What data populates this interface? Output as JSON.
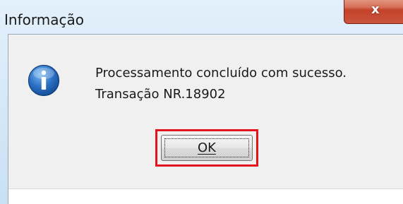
{
  "window": {
    "title": "Informação",
    "close_label": "x"
  },
  "dialog": {
    "icon": "info-icon",
    "message_line1": "Processamento concluído com sucesso.",
    "message_line2": "Transação NR.18902",
    "ok_label": "OK"
  },
  "colors": {
    "highlight": "#e3141c",
    "close_button": "#c3422a",
    "info_icon": "#1e5fb4"
  }
}
